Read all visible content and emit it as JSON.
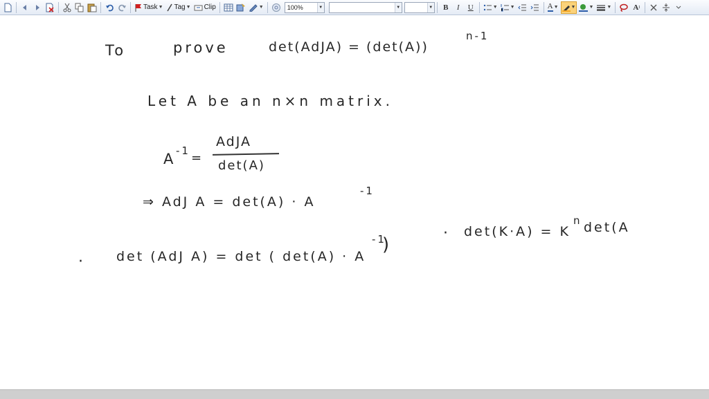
{
  "toolbar": {
    "task_label": "Task",
    "tag_label": "Tag",
    "clip_label": "Clip",
    "zoom_value": "100%",
    "font_value": "",
    "size_value": "",
    "bold_label": "B",
    "italic_label": "I",
    "underline_label": "U",
    "font_color_label": "A",
    "superscript_label": "A",
    "colors": {
      "highlight": "#f5a623",
      "pen": "#f5a623",
      "accent": "#2a5ca8"
    }
  },
  "notes": {
    "line1_to": "To",
    "line1_prove": "prove",
    "line1_expr": "det(AdJA) = (det(A))",
    "line1_exp": "n-1",
    "line2": "Let A be an n×n matrix.",
    "line3_lhs": "A",
    "line3_lhs_exp": "-1",
    "line3_eq": "=",
    "line3_num": "AdJA",
    "line3_den": "det(A)",
    "line4": "⇒ AdJ A = det(A) · A",
    "line4_exp": "-1",
    "line5_bullet": "·",
    "line5_expr": "det (AdJ A) = det ( det(A) · A",
    "line5_exp": "-1",
    "line5_close": ")",
    "line6_bullet": "·",
    "line6_expr": "det(K·A) = K",
    "line6_exp": "n",
    "line6_tail": "det(A"
  }
}
